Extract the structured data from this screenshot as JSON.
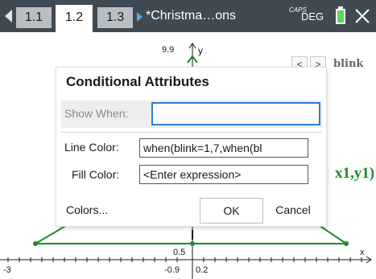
{
  "topbar": {
    "tabs": [
      "1.1",
      "1.2",
      "1.3"
    ],
    "active_tab": "1.2",
    "doc_title": "*Christma…ons",
    "caps": "CAPS",
    "angle_mode": "DEG"
  },
  "graph": {
    "y_axis_label": "y",
    "y_max_label": "9.9",
    "x_axis_label": "x",
    "x_min_label": "-3",
    "y_min_label": "-0.9",
    "x_tick_label": "0.2",
    "line_label": "0.5",
    "slider_name": "blink",
    "point_label": "x1,y1)",
    "curve_color": "#1e8a2e"
  },
  "dialog": {
    "title": "Conditional Attributes",
    "show_when_label": "Show When:",
    "show_when_value": "",
    "line_color_label": "Line Color:",
    "line_color_value": "when(blink=1,7,when(bl",
    "fill_color_label": "Fill Color:",
    "fill_color_value": "<Enter expression>",
    "colors_button": "Colors...",
    "ok_button": "OK",
    "cancel_button": "Cancel"
  }
}
